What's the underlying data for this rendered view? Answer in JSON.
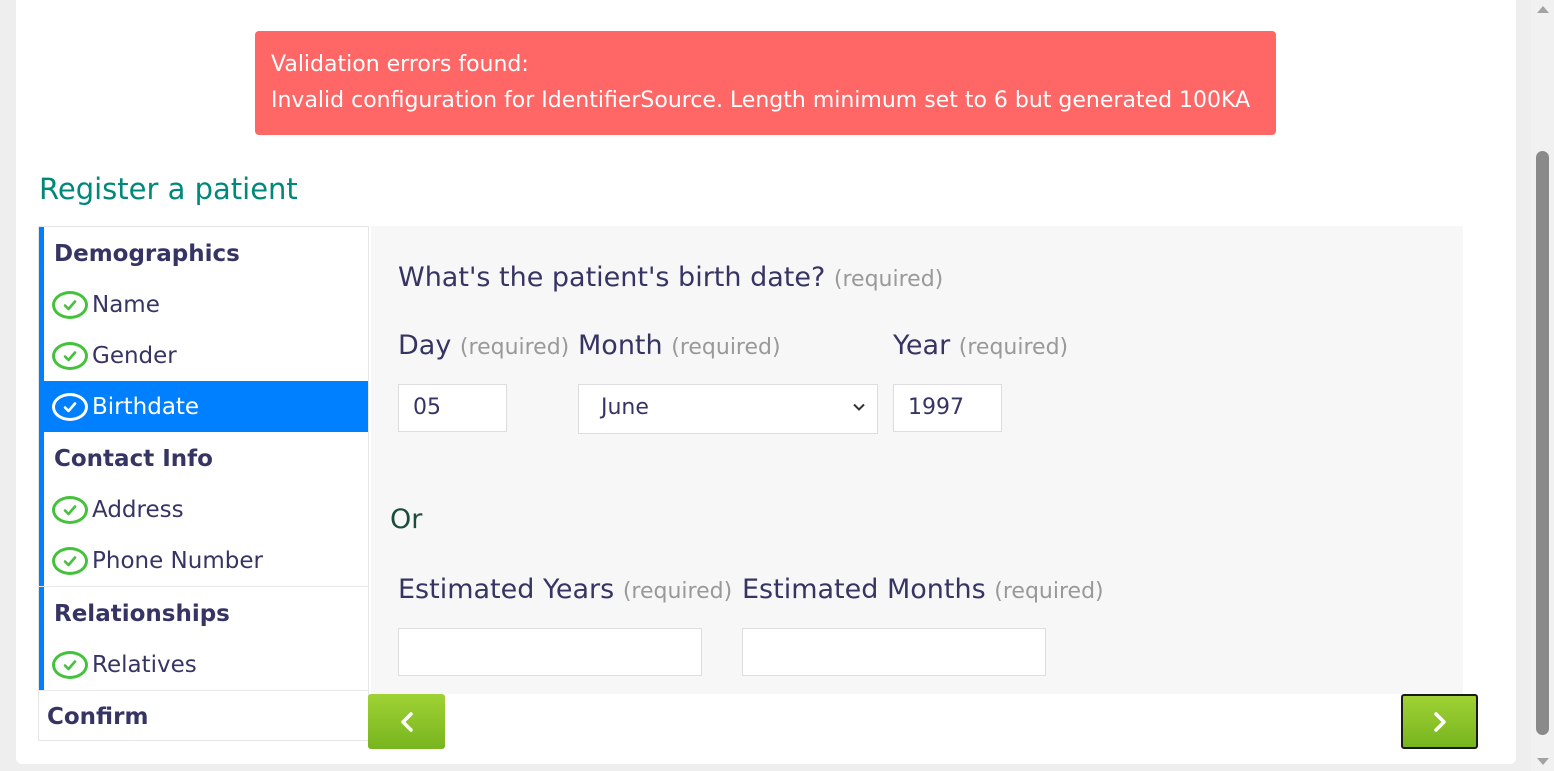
{
  "alert": {
    "line1": "Validation errors found:",
    "line2": "Invalid configuration for IdentifierSource. Length minimum set to 6 but generated 100KA"
  },
  "page_title": "Register a patient",
  "sidebar": {
    "sections": [
      {
        "label": "Demographics",
        "items": [
          {
            "label": "Name",
            "status": "check-icon",
            "active": false
          },
          {
            "label": "Gender",
            "status": "check-icon",
            "active": false
          },
          {
            "label": "Birthdate",
            "status": "check-icon",
            "active": true
          }
        ]
      },
      {
        "label": "Contact Info",
        "items": [
          {
            "label": "Address",
            "status": "check-icon",
            "active": false
          },
          {
            "label": "Phone Number",
            "status": "check-icon",
            "active": false
          }
        ]
      },
      {
        "label": "Relationships",
        "items": [
          {
            "label": "Relatives",
            "status": "check-icon",
            "active": false
          }
        ]
      }
    ],
    "confirm_label": "Confirm"
  },
  "form": {
    "question": "What's the patient's birth date?",
    "required_text": "(required)",
    "day_label": "Day",
    "day_value": "05",
    "month_label": "Month",
    "month_value": "June",
    "year_label": "Year",
    "year_value": "1997",
    "or_text": "Or",
    "est_years_label": "Estimated Years",
    "est_years_value": "",
    "est_months_label": "Estimated Months",
    "est_months_value": ""
  },
  "nav": {
    "prev_icon": "chevron-left-icon",
    "next_icon": "chevron-right-icon"
  },
  "colors": {
    "alert_bg": "#ff6666",
    "title": "#00897b",
    "active_item": "#007fff",
    "check": "#44c23b",
    "button": "#88c425"
  }
}
